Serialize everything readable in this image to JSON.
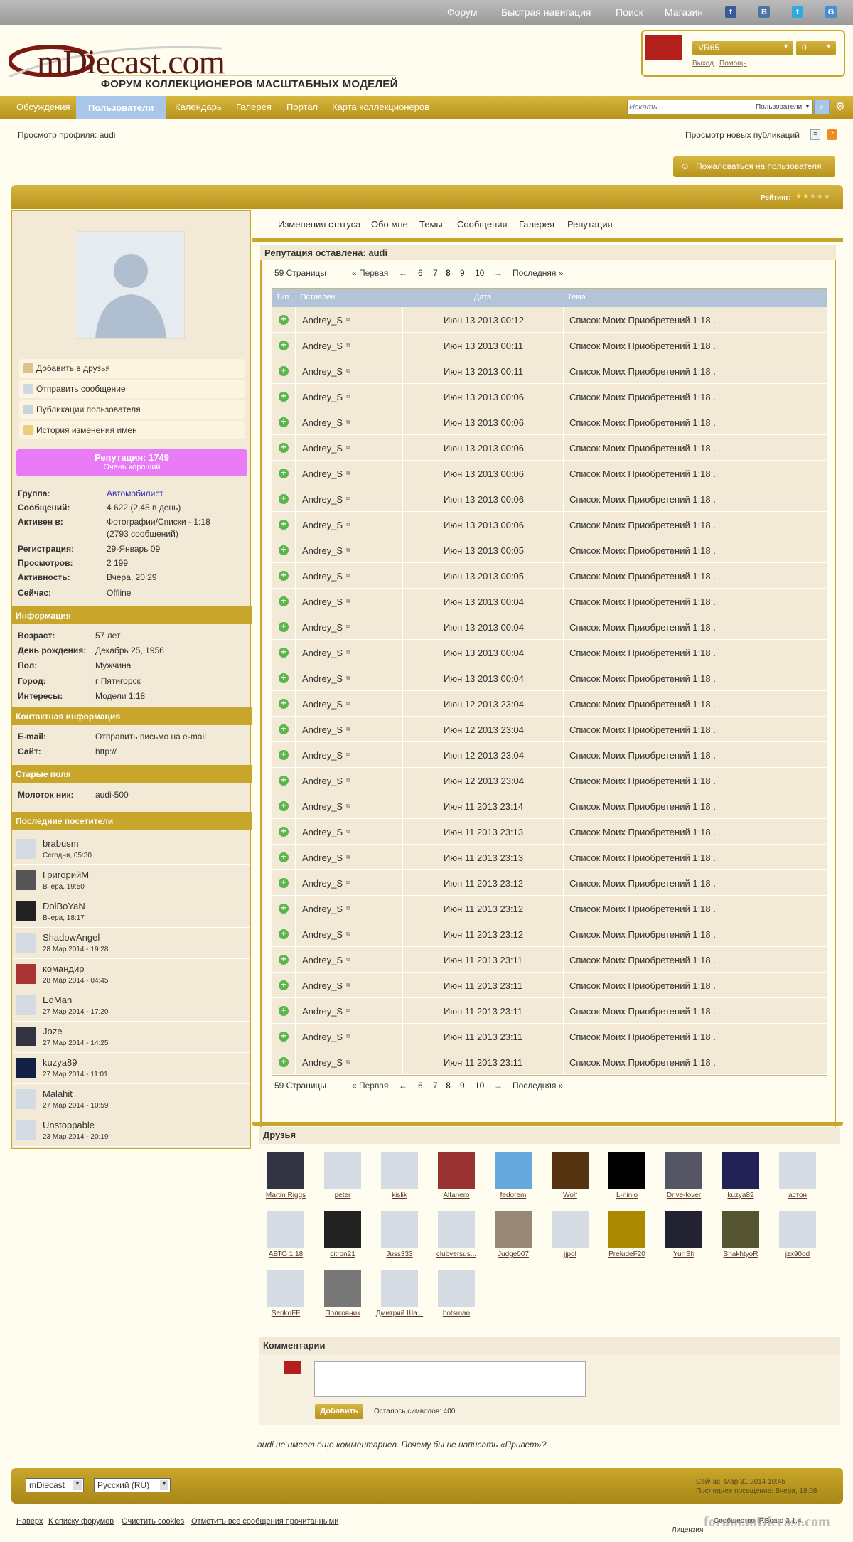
{
  "header": {
    "nav_links": [
      "Форум",
      "Быстрая навигация",
      "Поиск",
      "Магазин"
    ],
    "social": [
      "f",
      "B",
      "t",
      "G"
    ],
    "logo_brand": "mDiecast.com",
    "logo_sub": "ФОРУМ КОЛЛЕКЦИОНЕРОВ МАСШТАБНЫХ МОДЕЛЕЙ",
    "user": {
      "name": "VR65",
      "count": "0",
      "logout": "Выход",
      "help": "Помощь"
    }
  },
  "navbar": {
    "tabs": [
      "Обсуждения",
      "Пользователи",
      "Календарь",
      "Галерея",
      "Портал",
      "Карта коллекционеров"
    ],
    "active": 1,
    "search_placeholder": "Искать...",
    "search_scope": "Пользователи"
  },
  "breadcrumb": "Просмотр профиля: audi",
  "new_pubs": "Просмотр новых публикаций",
  "report_button": "Пожаловаться на пользователя",
  "rating_label": "Рейтинг:",
  "sidebar": {
    "actions": [
      "Добавить в друзья",
      "Отправить сообщение",
      "Публикации пользователя",
      "История изменения имен"
    ],
    "rep_label": "Репутация: 1749",
    "rep_sub": "Очень хороший",
    "stats": [
      {
        "k": "Группа:",
        "v": "Автомобилист"
      },
      {
        "k": "Сообщений:",
        "v": "4 622 (2,45 в день)"
      },
      {
        "k": "Активен в:",
        "v": "Фотографии/Списки - 1:18"
      },
      {
        "k": "",
        "v": "(2793 сообщений)"
      },
      {
        "k": "Регистрация:",
        "v": "29-Январь 09"
      },
      {
        "k": "Просмотров:",
        "v": "2 199"
      },
      {
        "k": "Активность:",
        "v": "Вчера, 20:29"
      },
      {
        "k": "Сейчас:",
        "v": "Offline"
      }
    ],
    "info_head": "Информация",
    "info": [
      {
        "k": "Возраст:",
        "v": "57 лет"
      },
      {
        "k": "День рождения:",
        "v": "Декабрь 25, 1956"
      },
      {
        "k": "Пол:",
        "v": "Мужчина"
      },
      {
        "k": "Город:",
        "v": "г Пятигорск"
      },
      {
        "k": "Интересы:",
        "v": "Модели 1:18"
      }
    ],
    "contact_head": "Контактная информация",
    "contact": [
      {
        "k": "E-mail:",
        "v": "Отправить письмо на e-mail"
      },
      {
        "k": "Сайт:",
        "v": "http://"
      }
    ],
    "old_head": "Старые поля",
    "old": [
      {
        "k": "Молоток ник:",
        "v": "audi-500"
      }
    ],
    "visitors_head": "Последние посетители",
    "visitors": [
      {
        "n": "brabusm",
        "t": "Сегодня, 05:30"
      },
      {
        "n": "ГригорийМ",
        "t": "Вчера, 19:50"
      },
      {
        "n": "DolBoYaN",
        "t": "Вчера, 18:17"
      },
      {
        "n": "ShadowAngel",
        "t": "28 Мар 2014 - 19:28"
      },
      {
        "n": "командир",
        "t": "28 Мар 2014 - 04:45"
      },
      {
        "n": "EdMan",
        "t": "27 Мар 2014 - 17:20"
      },
      {
        "n": "Joze",
        "t": "27 Мар 2014 - 14:25"
      },
      {
        "n": "kuzya89",
        "t": "27 Мар 2014 - 11:01"
      },
      {
        "n": "Malahit",
        "t": "27 Мар 2014 - 10:59"
      },
      {
        "n": "Unstoppable",
        "t": "23 Мар 2014 - 20:19"
      }
    ]
  },
  "profile_tabs": [
    "Изменения статуса",
    "Обо мне",
    "Темы",
    "Сообщения",
    "Галерея",
    "Репутация"
  ],
  "rep_title": "Репутация оставлена: audi",
  "pagination": {
    "pages": "59 Страницы",
    "first": "« Первая",
    "prev": "←",
    "nums": [
      "6",
      "7",
      "8",
      "9",
      "10"
    ],
    "current": "8",
    "next": "→",
    "last": "Последняя »"
  },
  "table": {
    "headers": [
      "Тип",
      "Оставлен",
      "Дата",
      "Тема"
    ],
    "rows": [
      [
        "Andrey_S",
        "Июн 13 2013 00:12",
        "Список Моих Приобретений 1:18 ."
      ],
      [
        "Andrey_S",
        "Июн 13 2013 00:11",
        "Список Моих Приобретений 1:18 ."
      ],
      [
        "Andrey_S",
        "Июн 13 2013 00:11",
        "Список Моих Приобретений 1:18 ."
      ],
      [
        "Andrey_S",
        "Июн 13 2013 00:06",
        "Список Моих Приобретений 1:18 ."
      ],
      [
        "Andrey_S",
        "Июн 13 2013 00:06",
        "Список Моих Приобретений 1:18 ."
      ],
      [
        "Andrey_S",
        "Июн 13 2013 00:06",
        "Список Моих Приобретений 1:18 ."
      ],
      [
        "Andrey_S",
        "Июн 13 2013 00:06",
        "Список Моих Приобретений 1:18 ."
      ],
      [
        "Andrey_S",
        "Июн 13 2013 00:06",
        "Список Моих Приобретений 1:18 ."
      ],
      [
        "Andrey_S",
        "Июн 13 2013 00:06",
        "Список Моих Приобретений 1:18 ."
      ],
      [
        "Andrey_S",
        "Июн 13 2013 00:05",
        "Список Моих Приобретений 1:18 ."
      ],
      [
        "Andrey_S",
        "Июн 13 2013 00:05",
        "Список Моих Приобретений 1:18 ."
      ],
      [
        "Andrey_S",
        "Июн 13 2013 00:04",
        "Список Моих Приобретений 1:18 ."
      ],
      [
        "Andrey_S",
        "Июн 13 2013 00:04",
        "Список Моих Приобретений 1:18 ."
      ],
      [
        "Andrey_S",
        "Июн 13 2013 00:04",
        "Список Моих Приобретений 1:18 ."
      ],
      [
        "Andrey_S",
        "Июн 13 2013 00:04",
        "Список Моих Приобретений 1:18 ."
      ],
      [
        "Andrey_S",
        "Июн 12 2013 23:04",
        "Список Моих Приобретений 1:18 ."
      ],
      [
        "Andrey_S",
        "Июн 12 2013 23:04",
        "Список Моих Приобретений 1:18 ."
      ],
      [
        "Andrey_S",
        "Июн 12 2013 23:04",
        "Список Моих Приобретений 1:18 ."
      ],
      [
        "Andrey_S",
        "Июн 12 2013 23:04",
        "Список Моих Приобретений 1:18 ."
      ],
      [
        "Andrey_S",
        "Июн 11 2013 23:14",
        "Список Моих Приобретений 1:18 ."
      ],
      [
        "Andrey_S",
        "Июн 11 2013 23:13",
        "Список Моих Приобретений 1:18 ."
      ],
      [
        "Andrey_S",
        "Июн 11 2013 23:13",
        "Список Моих Приобретений 1:18 ."
      ],
      [
        "Andrey_S",
        "Июн 11 2013 23:12",
        "Список Моих Приобретений 1:18 ."
      ],
      [
        "Andrey_S",
        "Июн 11 2013 23:12",
        "Список Моих Приобретений 1:18 ."
      ],
      [
        "Andrey_S",
        "Июн 11 2013 23:12",
        "Список Моих Приобретений 1:18 ."
      ],
      [
        "Andrey_S",
        "Июн 11 2013 23:11",
        "Список Моих Приобретений 1:18 ."
      ],
      [
        "Andrey_S",
        "Июн 11 2013 23:11",
        "Список Моих Приобретений 1:18 ."
      ],
      [
        "Andrey_S",
        "Июн 11 2013 23:11",
        "Список Моих Приобретений 1:18 ."
      ],
      [
        "Andrey_S",
        "Июн 11 2013 23:11",
        "Список Моих Приобретений 1:18 ."
      ],
      [
        "Andrey_S",
        "Июн 11 2013 23:11",
        "Список Моих Приобретений 1:18 ."
      ]
    ]
  },
  "friends_title": "Друзья",
  "friends": [
    "Martin Riggs",
    "peter",
    "kislik",
    "Alfanero",
    "fedorem",
    "Wolf",
    "L-ninio",
    "Drive-lover",
    "kuzya89",
    "астон",
    "АВТО 1:18",
    "citron21",
    "Juss333",
    "clubversus...",
    "Judge007",
    "jjpol",
    "PreludeF20",
    "YurISh",
    "ShakhtyoR",
    "jzx90od",
    "SerikoFF",
    "Полковник",
    "Дмитрий Ша...",
    "botsman"
  ],
  "comments_title": "Комментарии",
  "add_button": "Добавить",
  "chars_left": "Осталось символов: 400",
  "no_comments": "audi не имеет еще комментариев. Почему бы не написать «Привет»?",
  "footer": {
    "skin": "mDiecast",
    "lang": "Русский (RU)",
    "now": "Сейчас: Мар 31 2014 10:45",
    "last": "Последнее посещение: Вчера, 18:08",
    "links": [
      "Наверх",
      "К списку форумов",
      "Очистить cookies",
      "Отметить все сообщения прочитанными"
    ],
    "copy": "Сообщество IP.Board 3.1.4.",
    "license": "Лицензия",
    "watermark": "forum.mDiecast.com"
  },
  "colors": {
    "accent": "#c8a52b",
    "rep": "#e97cf6",
    "active_tab": "#a9c5e8",
    "table_head": "#b4c4d8"
  }
}
